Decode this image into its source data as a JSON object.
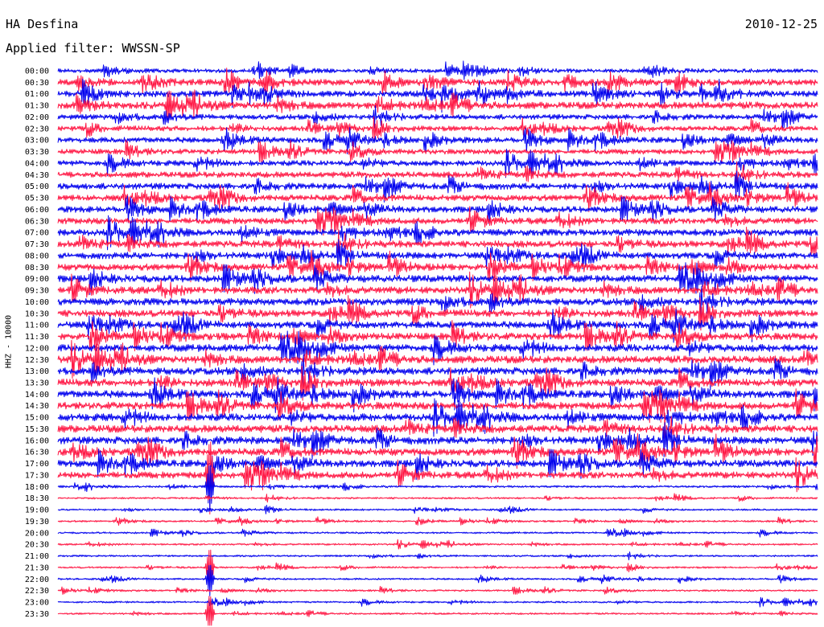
{
  "header": {
    "station": "HA Desfina",
    "date": "2010-12-25",
    "filter": "Applied filter: WWSSN-SP"
  },
  "chart_data": {
    "type": "line",
    "plot_kind": "helicorder",
    "title": "HA Desfina",
    "subtitle": "Applied filter: WWSSN-SP",
    "date": "2010-12-25",
    "ylabel": "HHZ - 10000",
    "xlabel": "",
    "row_interval_minutes": 30,
    "trace_colors": [
      "#0000ee",
      "#ff1744"
    ],
    "row_labels": [
      "00:00",
      "00:30",
      "01:00",
      "01:30",
      "02:00",
      "02:30",
      "03:00",
      "03:30",
      "04:00",
      "04:30",
      "05:00",
      "05:30",
      "06:00",
      "06:30",
      "07:00",
      "07:30",
      "08:00",
      "08:30",
      "09:00",
      "09:30",
      "10:00",
      "10:30",
      "11:00",
      "11:30",
      "12:00",
      "12:30",
      "13:00",
      "13:30",
      "14:00",
      "14:30",
      "15:00",
      "15:30",
      "16:00",
      "16:30",
      "17:00",
      "17:30",
      "18:00",
      "18:30",
      "19:00",
      "19:30",
      "20:00",
      "20:30",
      "21:00",
      "21:30",
      "22:00",
      "22:30",
      "23:00",
      "23:30"
    ],
    "noise_level": [
      0.55,
      0.85,
      0.85,
      0.95,
      0.7,
      0.7,
      0.75,
      0.7,
      0.75,
      0.8,
      0.85,
      0.85,
      0.85,
      0.85,
      0.9,
      0.9,
      0.9,
      0.9,
      0.95,
      0.95,
      0.95,
      0.95,
      0.95,
      0.95,
      1.0,
      1.0,
      1.0,
      1.0,
      1.0,
      1.0,
      1.0,
      1.0,
      1.0,
      1.0,
      0.95,
      0.9,
      0.3,
      0.25,
      0.25,
      0.25,
      0.25,
      0.25,
      0.25,
      0.25,
      0.25,
      0.25,
      0.25,
      0.25
    ],
    "events": [
      {
        "row_label": "17:30",
        "minute": 6,
        "amplitude": 4.5
      },
      {
        "row_label": "18:00",
        "minute": 6,
        "amplitude": 3.0
      },
      {
        "row_label": "21:30",
        "minute": 6,
        "amplitude": 2.5
      },
      {
        "row_label": "22:00",
        "minute": 6,
        "amplitude": 2.0
      },
      {
        "row_label": "23:30",
        "minute": 6,
        "amplitude": 2.5
      }
    ]
  }
}
